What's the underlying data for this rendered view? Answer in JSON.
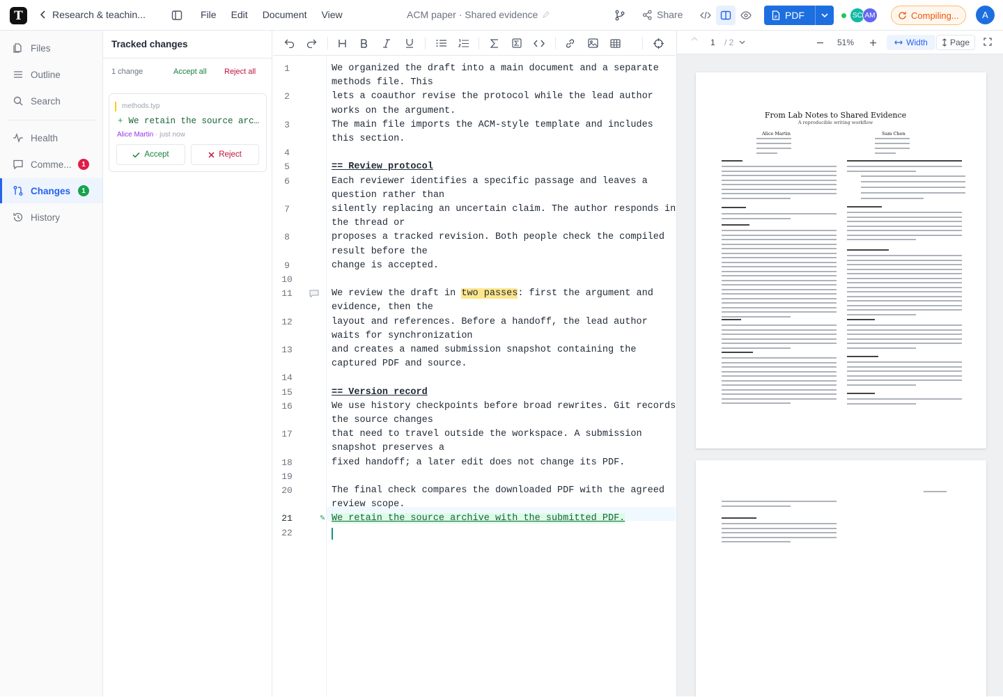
{
  "topbar": {
    "project_name": "Research & teachin...",
    "menu": [
      "File",
      "Edit",
      "Document",
      "View"
    ],
    "doc_title": "ACM paper · Shared evidence",
    "share_label": "Share",
    "pdf_label": "PDF",
    "avatars": [
      {
        "initials": "SC",
        "color": "#14b8a6"
      },
      {
        "initials": "AM",
        "color": "#6366f1"
      }
    ],
    "compile_status": "Compiling...",
    "user_initial": "A",
    "logo_letter": "T"
  },
  "sidebar": {
    "items": [
      {
        "label": "Files",
        "icon": "files-icon"
      },
      {
        "label": "Outline",
        "icon": "outline-icon"
      },
      {
        "label": "Search",
        "icon": "search-icon"
      },
      {
        "label": "Health",
        "icon": "health-icon"
      },
      {
        "label": "Comme...",
        "icon": "comments-icon",
        "badge": "1",
        "badge_color": "#e11d48"
      },
      {
        "label": "Changes",
        "icon": "changes-icon",
        "badge": "1",
        "badge_color": "#16a34a",
        "active": true
      },
      {
        "label": "History",
        "icon": "history-icon"
      }
    ]
  },
  "changes_panel": {
    "title": "Tracked changes",
    "count": "1 change",
    "accept_all": "Accept all",
    "reject_all": "Reject all",
    "card": {
      "file": "methods.typ",
      "text": "We retain the source arc...",
      "author": "Alice Martin",
      "time": "· just now",
      "accept": "Accept",
      "reject": "Reject"
    }
  },
  "editor": {
    "lines": [
      {
        "n": "1",
        "text": "We organized the draft into a main document and a separate"
      },
      {
        "n": "",
        "text": "methods file. This"
      },
      {
        "n": "2",
        "text": "lets a coauthor revise the protocol while the lead author"
      },
      {
        "n": "",
        "text": "works on the argument."
      },
      {
        "n": "3",
        "text": "The main file imports the ACM-style template and includes"
      },
      {
        "n": "",
        "text": "this section."
      },
      {
        "n": "4",
        "text": ""
      },
      {
        "n": "5",
        "text": "== Review protocol",
        "kind": "heading"
      },
      {
        "n": "6",
        "text": "Each reviewer identifies a specific passage and leaves a"
      },
      {
        "n": "",
        "text": "question rather than"
      },
      {
        "n": "7",
        "text": "silently replacing an uncertain claim. The author responds in"
      },
      {
        "n": "",
        "text": "the thread or"
      },
      {
        "n": "8",
        "text": "proposes a tracked revision. Both people check the compiled"
      },
      {
        "n": "",
        "text": "result before the"
      },
      {
        "n": "9",
        "text": "change is accepted."
      },
      {
        "n": "10",
        "text": ""
      },
      {
        "n": "11",
        "text": "We review the draft in ",
        "hl": "two passes",
        "after": ": first the argument and",
        "comment": true
      },
      {
        "n": "",
        "text": "evidence, then the"
      },
      {
        "n": "12",
        "text": "layout and references. Before a handoff, the lead author"
      },
      {
        "n": "",
        "text": "waits for synchronization"
      },
      {
        "n": "13",
        "text": "and creates a named submission snapshot containing the"
      },
      {
        "n": "",
        "text": "captured PDF and source."
      },
      {
        "n": "14",
        "text": ""
      },
      {
        "n": "15",
        "text": "== Version record",
        "kind": "heading"
      },
      {
        "n": "16",
        "text": "We use history checkpoints before broad rewrites. Git records"
      },
      {
        "n": "",
        "text": "the source changes"
      },
      {
        "n": "17",
        "text": "that need to travel outside the workspace. A submission"
      },
      {
        "n": "",
        "text": "snapshot preserves a"
      },
      {
        "n": "18",
        "text": "fixed handoff; a later edit does not change its PDF."
      },
      {
        "n": "19",
        "text": ""
      },
      {
        "n": "20",
        "text": "The final check compares the downloaded PDF with the agreed"
      },
      {
        "n": "",
        "text": "review scope."
      },
      {
        "n": "21",
        "text": "We retain the source archive with the submitted PDF.",
        "kind": "added",
        "active": true
      },
      {
        "n": "22",
        "text": ""
      }
    ]
  },
  "pdf": {
    "page": "1",
    "total": "/ 2",
    "zoom": "51%",
    "width_label": "Width",
    "page_label": "Page",
    "paper": {
      "title": "From Lab Notes to Shared Evidence",
      "subtitle": "A reproducible writing workflow",
      "authors": [
        "Alice Martin",
        "Sam Chen"
      ]
    }
  },
  "colors": {
    "accent": "#2563eb",
    "added": "#166534",
    "warning": "#ea580c"
  }
}
